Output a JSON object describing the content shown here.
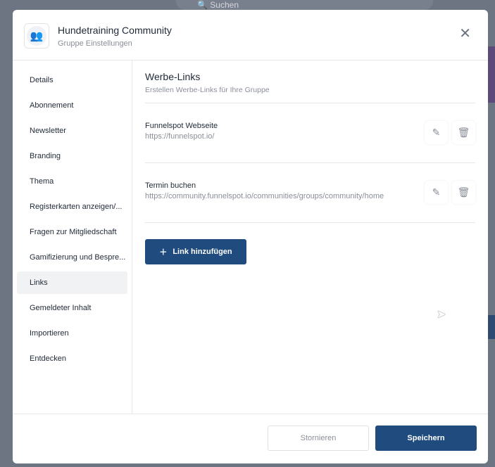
{
  "background": {
    "search_placeholder": "Suchen"
  },
  "header": {
    "title": "Hundetraining Community",
    "subtitle": "Gruppe Einstellungen",
    "close_icon": "close-icon"
  },
  "sidebar": {
    "items": [
      {
        "label": "Details"
      },
      {
        "label": "Abonnement"
      },
      {
        "label": "Newsletter"
      },
      {
        "label": "Branding"
      },
      {
        "label": "Thema"
      },
      {
        "label": "Registerkarten anzeigen/..."
      },
      {
        "label": "Fragen zur Mitgliedschaft"
      },
      {
        "label": "Gamifizierung und Bespre..."
      },
      {
        "label": "Links",
        "active": true
      },
      {
        "label": "Gemeldeter Inhalt"
      },
      {
        "label": "Importieren"
      },
      {
        "label": "Entdecken"
      }
    ]
  },
  "main": {
    "title": "Werbe-Links",
    "subtitle": "Erstellen Werbe-Links für Ihre Gruppe",
    "links": [
      {
        "name": "Funnelspot Webseite",
        "url": "https://funnelspot.io/"
      },
      {
        "name": "Termin buchen",
        "url": "https://community.funnelspot.io/communities/groups/community/home"
      }
    ],
    "add_label": "Link hinzufügen"
  },
  "footer": {
    "cancel_label": "Stornieren",
    "save_label": "Speichern"
  },
  "colors": {
    "primary": "#1f4b7e"
  }
}
